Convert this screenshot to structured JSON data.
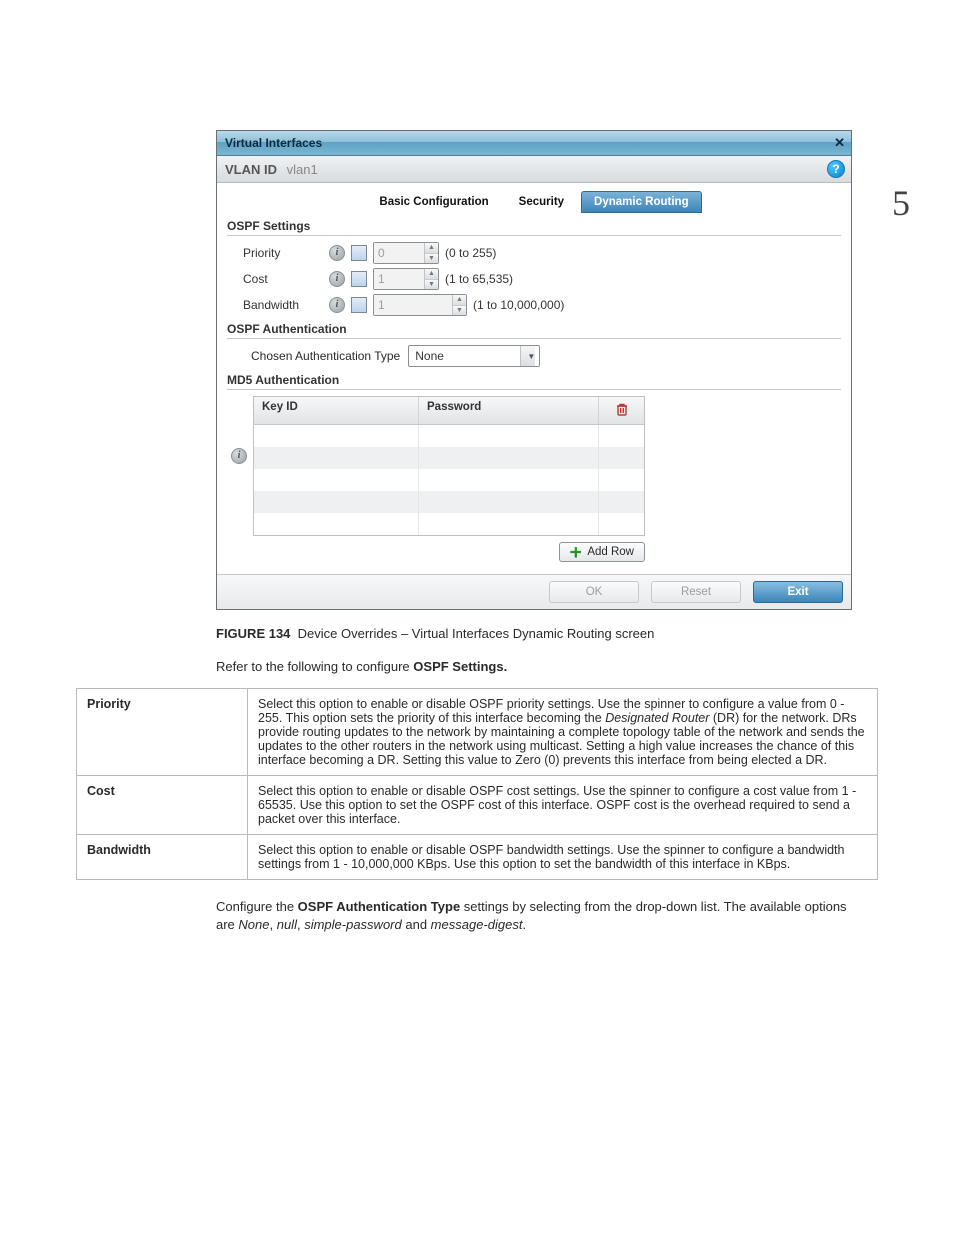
{
  "page_number": "5",
  "dialog": {
    "title": "Virtual Interfaces",
    "close": "✕",
    "vlan_label": "VLAN ID",
    "vlan_value": "vlan1",
    "help": "?",
    "tabs": [
      "Basic Configuration",
      "Security",
      "Dynamic Routing"
    ],
    "active_tab_index": 2,
    "ospf_settings": {
      "heading": "OSPF Settings",
      "rows": [
        {
          "label": "Priority",
          "value": "0",
          "hint": "(0 to 255)"
        },
        {
          "label": "Cost",
          "value": "1",
          "hint": "(1 to 65,535)"
        },
        {
          "label": "Bandwidth",
          "value": "1",
          "hint": "(1 to 10,000,000)"
        }
      ]
    },
    "ospf_auth": {
      "heading": "OSPF Authentication",
      "type_label": "Chosen Authentication Type",
      "type_value": "None"
    },
    "md5": {
      "heading": "MD5 Authentication",
      "columns": [
        "Key ID",
        "Password"
      ],
      "rows": 5,
      "add_label": "Add Row"
    },
    "footer": {
      "ok": "OK",
      "reset": "Reset",
      "exit": "Exit"
    }
  },
  "figure": {
    "label": "FIGURE 134",
    "caption": "Device Overrides – Virtual Interfaces Dynamic Routing screen"
  },
  "intro_text_pre": "Refer to the following to configure ",
  "intro_text_bold": "OSPF Settings.",
  "table": {
    "rows": [
      {
        "name": "Priority",
        "desc_pre": "Select this option to enable or disable OSPF priority settings. Use the spinner to configure a value from 0 - 255. This option sets the priority of this interface becoming the ",
        "desc_em": "Designated Router",
        "desc_post": " (DR) for the network. DRs provide routing updates to the network by maintaining a complete topology table of the network and sends the updates to the other routers in the network using multicast. Setting a high value increases the chance of this interface becoming a DR. Setting this value to Zero (0) prevents this interface from being elected a DR."
      },
      {
        "name": "Cost",
        "desc_pre": "Select this option to enable or disable OSPF cost settings. Use the spinner to configure a cost value from 1 - 65535. Use this option to set the OSPF cost of this interface. OSPF cost is the overhead required to send a packet over this interface.",
        "desc_em": "",
        "desc_post": ""
      },
      {
        "name": "Bandwidth",
        "desc_pre": "Select this option to enable or disable OSPF bandwidth settings. Use the spinner to configure a bandwidth settings from 1 - 10,000,000 KBps. Use this option to set the bandwidth of this interface in KBps.",
        "desc_em": "",
        "desc_post": ""
      }
    ]
  },
  "auth_para_pre": "Configure the ",
  "auth_para_bold": "OSPF Authentication Type",
  "auth_para_mid": " settings by selecting from the drop-down list. The available options are ",
  "auth_para_opts": "None, null, simple-password and message-digest.",
  "auth_para_opts_italic": [
    "None",
    "null",
    "simple-password",
    "message-digest"
  ]
}
